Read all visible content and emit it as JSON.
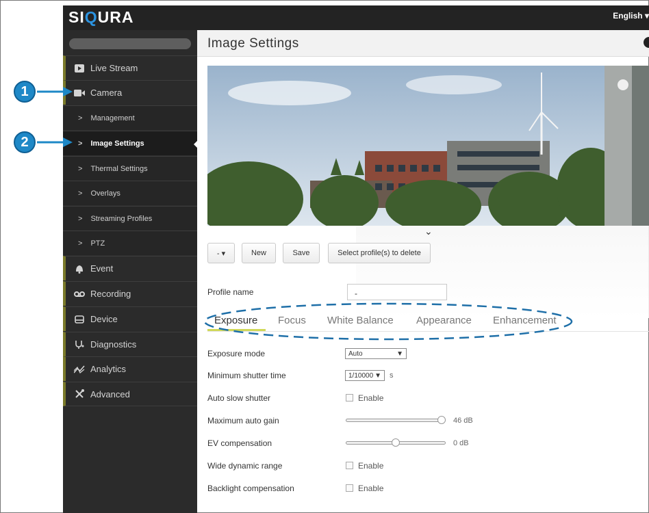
{
  "header": {
    "logo": {
      "pre": "SI",
      "accent": "Q",
      "post": "URA"
    },
    "language": "English ▾"
  },
  "sidebar": {
    "items": [
      {
        "label": "Live Stream",
        "icon": "play-icon"
      },
      {
        "label": "Camera",
        "icon": "camera-icon"
      },
      {
        "label": "Management",
        "sub": true
      },
      {
        "label": "Image Settings",
        "sub": true,
        "active": true
      },
      {
        "label": "Thermal Settings",
        "sub": true
      },
      {
        "label": "Overlays",
        "sub": true
      },
      {
        "label": "Streaming Profiles",
        "sub": true
      },
      {
        "label": "PTZ",
        "sub": true
      },
      {
        "label": "Event",
        "icon": "bell-icon"
      },
      {
        "label": "Recording",
        "icon": "recording-icon"
      },
      {
        "label": "Device",
        "icon": "device-icon"
      },
      {
        "label": "Diagnostics",
        "icon": "stethoscope-icon"
      },
      {
        "label": "Analytics",
        "icon": "analytics-icon"
      },
      {
        "label": "Advanced",
        "icon": "tools-icon"
      }
    ]
  },
  "annotations": {
    "step1": "1",
    "step2": "2"
  },
  "page": {
    "title": "Image Settings",
    "collapse_glyph": "⌄",
    "toolbar": {
      "profile_select": "- ▾",
      "new_label": "New",
      "save_label": "Save",
      "delete_label": "Select profile(s) to delete"
    },
    "profile_name_label": "Profile name",
    "profile_name_value": "-",
    "tabs": [
      "Exposure",
      "Focus",
      "White Balance",
      "Appearance",
      "Enhancement"
    ],
    "settings": {
      "exposure_mode": {
        "label": "Exposure mode",
        "value": "Auto"
      },
      "min_shutter": {
        "label": "Minimum shutter time",
        "value": "1/10000",
        "unit": "s"
      },
      "auto_slow_shutter": {
        "label": "Auto slow shutter",
        "checkbox_label": "Enable"
      },
      "max_auto_gain": {
        "label": "Maximum auto gain",
        "value_text": "46 dB",
        "level": 1.0
      },
      "ev_compensation": {
        "label": "EV compensation",
        "value_text": "0 dB",
        "level": 0.5
      },
      "wdr": {
        "label": "Wide dynamic range",
        "checkbox_label": "Enable"
      },
      "backlight": {
        "label": "Backlight compensation",
        "checkbox_label": "Enable"
      }
    }
  },
  "colors": {
    "accent": "#2b93e0",
    "annotation": "#1e88c7",
    "tab_underline": "#d0d858",
    "sidebar_bg": "#2b2b2b"
  }
}
